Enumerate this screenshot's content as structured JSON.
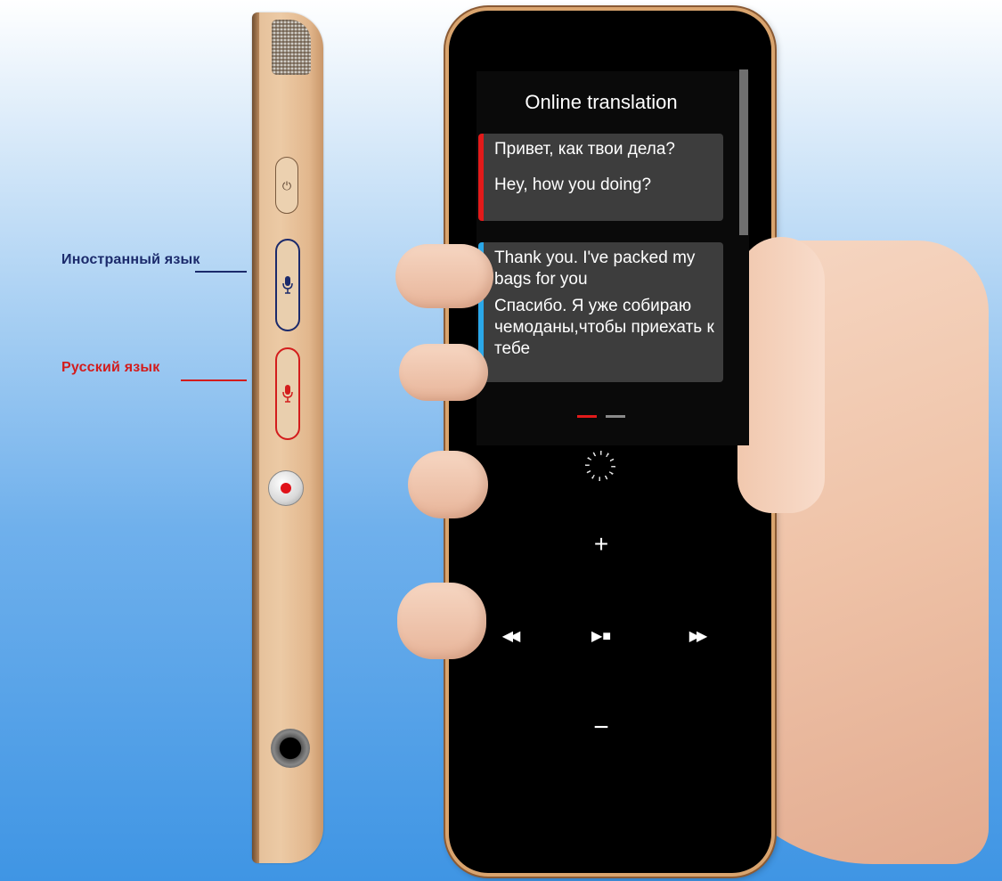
{
  "labels": {
    "foreign_language": "Иностранный язык",
    "russian_language": "Русский язык"
  },
  "screen": {
    "title": "Online translation",
    "messages": [
      {
        "source": "Привет, как твои дела?",
        "translation": "Hey, how you doing?",
        "accent_color": "#e21a1a"
      },
      {
        "source": "Thank you. I've packed my bags for you",
        "translation": "Спасибо. Я уже собираю чемоданы,чтобы приехать к тебе",
        "accent_color": "#2aa7e8"
      }
    ],
    "page_indicator": {
      "pages": 2,
      "active": 1
    }
  },
  "controls": {
    "volume_up": "+",
    "volume_down": "−",
    "previous": "◀◀",
    "play_stop": "▶■",
    "next": "▶▶"
  },
  "side_buttons": {
    "power_icon": "⏻",
    "mic_icon": "🎙"
  },
  "colors": {
    "foreign_accent": "#1b2a6b",
    "russian_accent": "#d31c1c",
    "device_gold": "#e6c29c"
  }
}
